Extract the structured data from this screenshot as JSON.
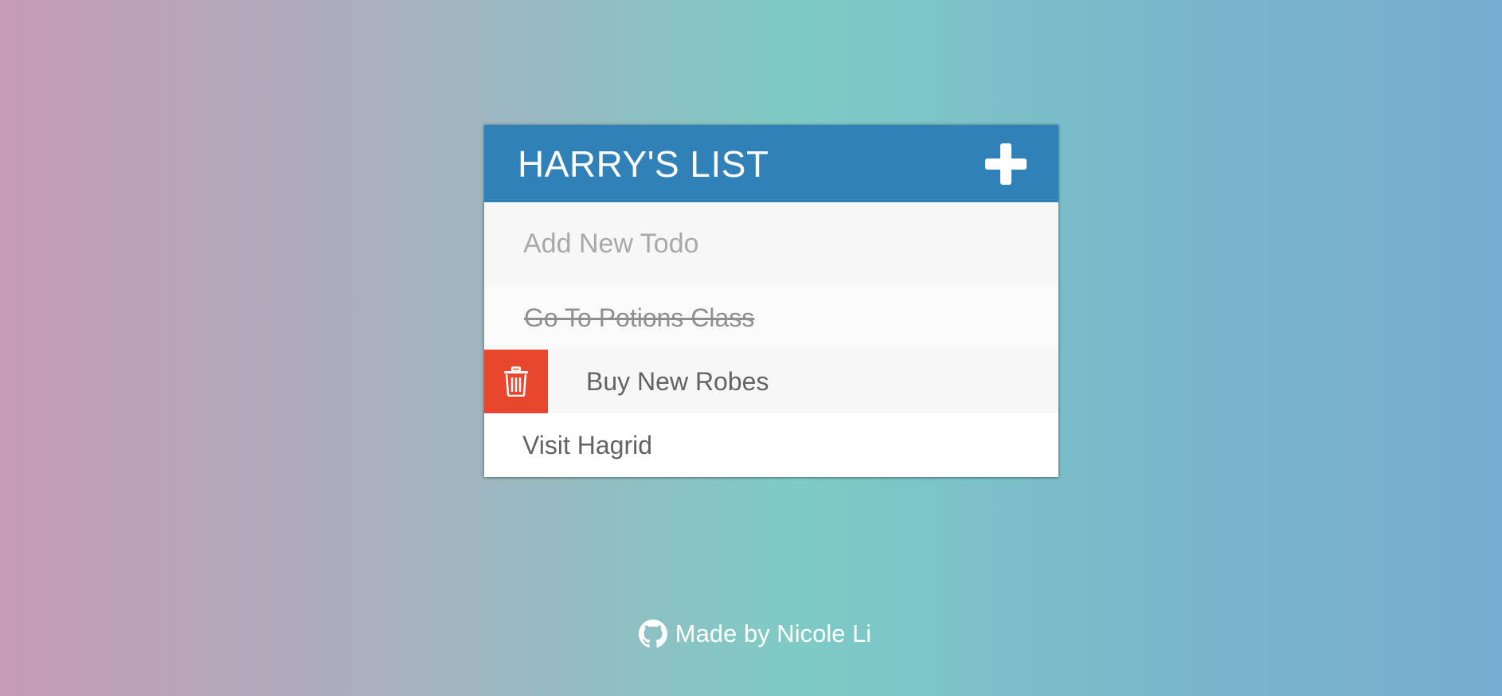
{
  "app": {
    "title": "HARRY'S LIST",
    "add_button_icon": "plus-icon"
  },
  "new_todo": {
    "placeholder": "Add New Todo",
    "value": ""
  },
  "todos": [
    {
      "text": "Go To Potions Class",
      "completed": true
    },
    {
      "text": "Buy New Robes",
      "completed": false,
      "delete_icon": "trash-icon"
    },
    {
      "text": "Visit Hagrid",
      "completed": false
    }
  ],
  "footer": {
    "icon": "github-icon",
    "text": "Made by Nicole Li"
  },
  "colors": {
    "header": "#2f81b8",
    "delete": "#e8472e"
  }
}
